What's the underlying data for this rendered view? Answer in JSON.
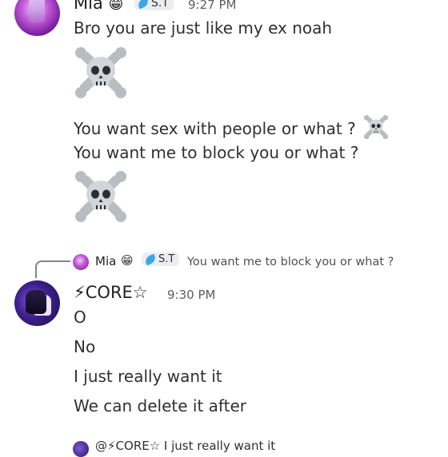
{
  "messages": [
    {
      "author": "Mia",
      "author_emoji": "😁",
      "role_badge": "S.T",
      "time": "9:27 PM",
      "lines": [
        "Bro you are just like my ex noah",
        "You want sex with people or what ?",
        "You want me to block you or what ?"
      ],
      "emojis": [
        "skull-and-crossbones-icon"
      ]
    },
    {
      "reply_to": {
        "author": "Mia",
        "author_emoji": "😁",
        "role_badge": "S.T",
        "text": "You want me to block you or what ?"
      },
      "author": "⚡CORE☆",
      "time": "9:30 PM",
      "lines": [
        "O",
        "No",
        "I just really want it",
        "We can delete it after"
      ]
    }
  ],
  "next_reply_preview": "@⚡CORE☆ I just really want it"
}
